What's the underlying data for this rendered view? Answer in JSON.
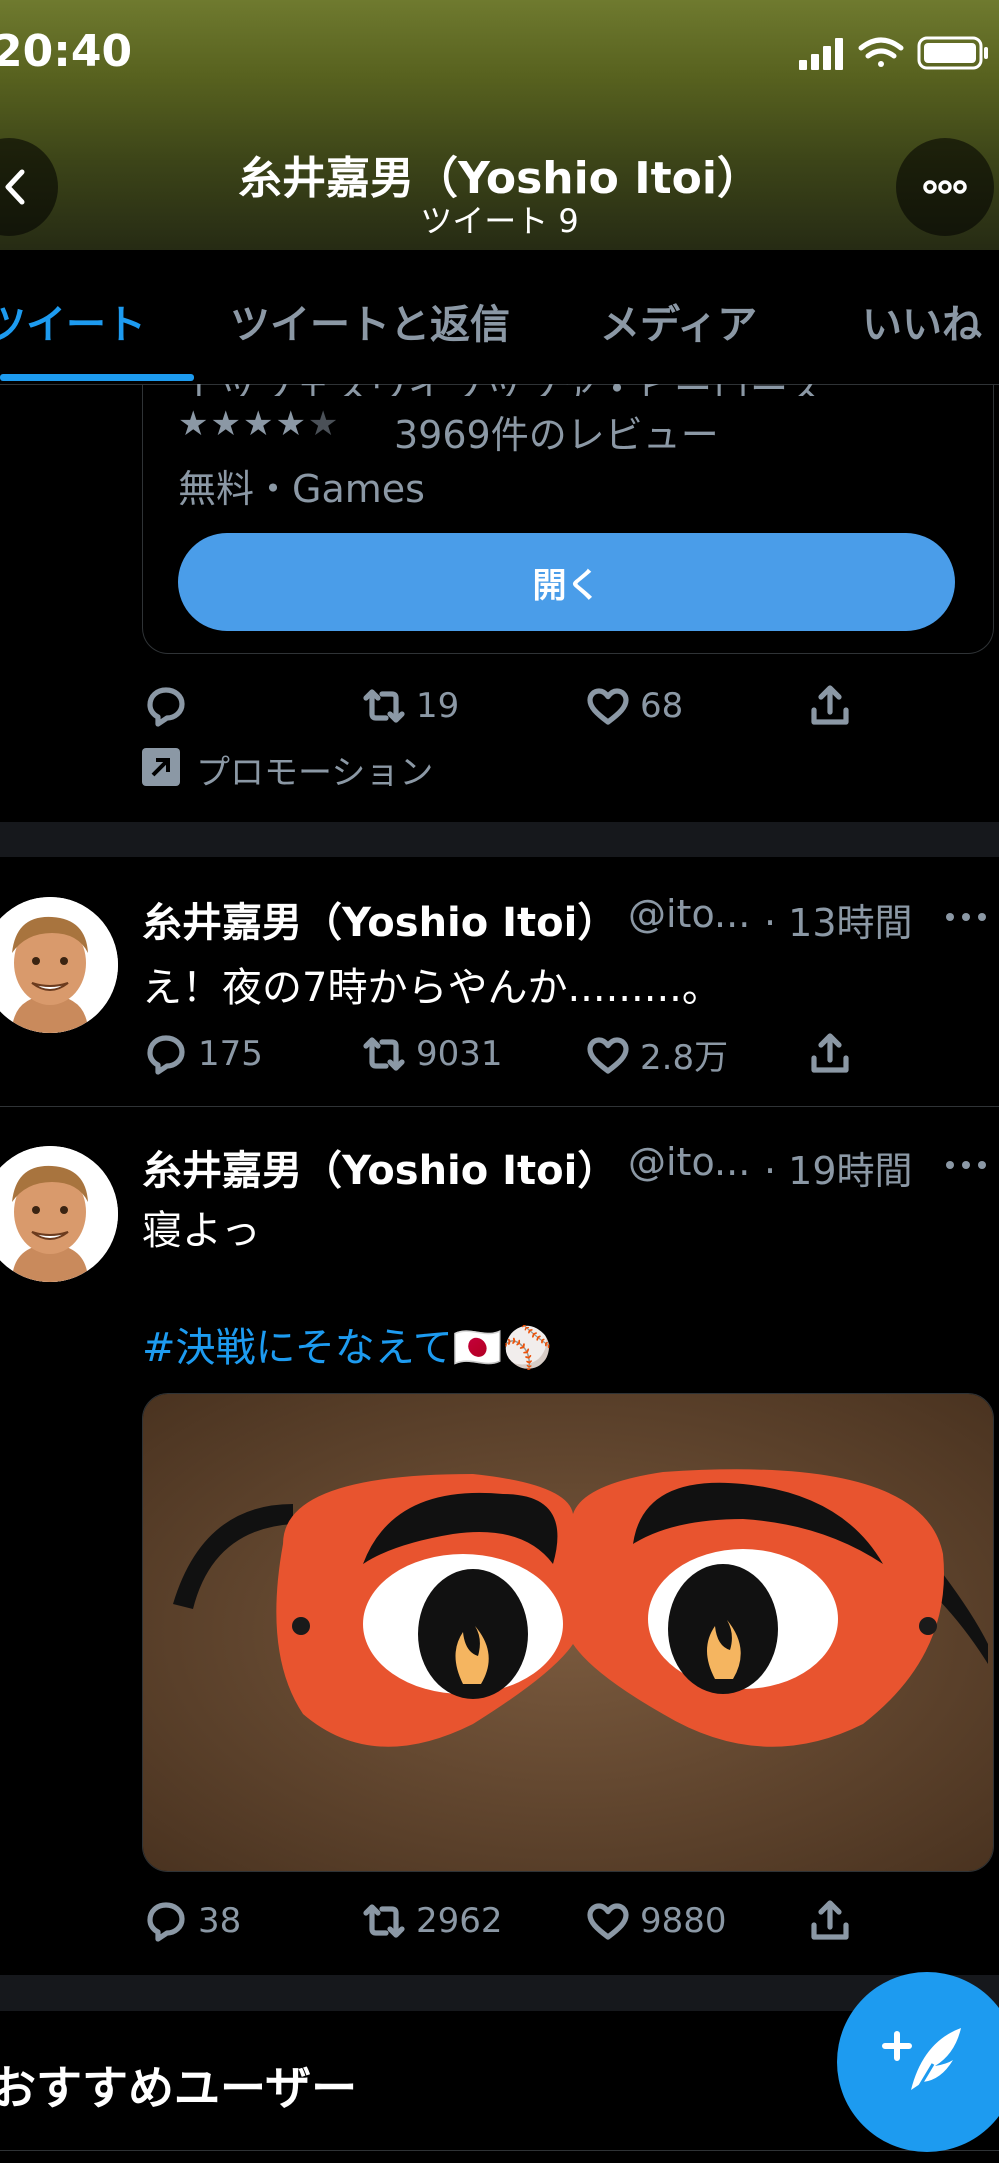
{
  "status_bar": {
    "time": "20:40"
  },
  "header": {
    "name": "糸井嘉男（Yoshio Itoi）",
    "tweet_count": "ツイート 9"
  },
  "tabs": [
    {
      "label": "ツイート",
      "active": true
    },
    {
      "label": "ツイートと返信",
      "active": false
    },
    {
      "label": "メディア",
      "active": false
    },
    {
      "label": "いいね",
      "active": false
    }
  ],
  "promo_card": {
    "cut_title": "エッフェスワイフッファ・ヒーローズ",
    "stars": "★★★★",
    "half_star": "★",
    "reviews": "3969件のレビュー",
    "price_category": "無料・Games",
    "open_button": "開く",
    "stats": {
      "replies": "",
      "retweets": "19",
      "likes": "68"
    },
    "promotion_label": "プロモーション"
  },
  "tweets": [
    {
      "name": "糸井嘉男（Yoshio Itoi）",
      "handle": "@ito...",
      "time": "· 13時間",
      "text": "え！夜の7時からやんか.........。",
      "stats": {
        "replies": "175",
        "retweets": "9031",
        "likes": "2.8万"
      }
    },
    {
      "name": "糸井嘉男（Yoshio Itoi）",
      "handle": "@ito...",
      "time": "· 19時間",
      "text": "寝よっ",
      "hashtag": "#決戦にそなえて",
      "emoji": "🇯🇵⚾",
      "stats": {
        "replies": "38",
        "retweets": "2962",
        "likes": "9880"
      }
    }
  ],
  "recommended": {
    "title": "おすすめユーザー"
  },
  "colors": {
    "accent": "#1d9bf0",
    "muted": "#8b98a5",
    "background": "#000000"
  }
}
